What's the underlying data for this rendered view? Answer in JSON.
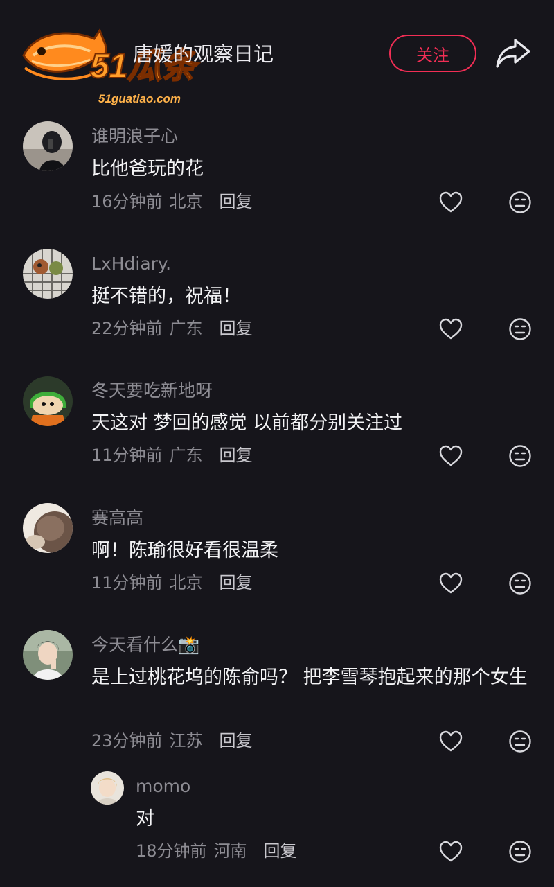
{
  "header": {
    "watermark_logo": "51瓜条",
    "watermark_site": "51guatiao.com",
    "title": "唐媛的观察日记",
    "follow_label": "关注"
  },
  "comments": [
    {
      "username": "谁明浪子心",
      "text": "比他爸玩的花",
      "time": "16分钟前",
      "location": "北京",
      "reply_label": "回复"
    },
    {
      "username": "LxHdiary.",
      "text": "挺不错的，祝福！",
      "time": "22分钟前",
      "location": "广东",
      "reply_label": "回复"
    },
    {
      "username": "冬天要吃新地呀",
      "text": "天这对 梦回的感觉 以前都分别关注过",
      "time": "11分钟前",
      "location": "广东",
      "reply_label": "回复"
    },
    {
      "username": "赛高高",
      "text": "啊！陈瑜很好看很温柔",
      "time": "11分钟前",
      "location": "北京",
      "reply_label": "回复"
    },
    {
      "username": "今天看什么📸",
      "text": "是上过桃花坞的陈俞吗？ 把李雪琴抱起来的那个女生",
      "time": "23分钟前",
      "location": "江苏",
      "reply_label": "回复"
    },
    {
      "username": "momo",
      "text": "对",
      "time": "18分钟前",
      "location": "河南",
      "reply_label": "回复"
    }
  ],
  "colors": {
    "background": "#16151b",
    "accent": "#f22e55",
    "secondary_text": "#8d8c93"
  },
  "icons": {
    "share": "share-arrow-icon",
    "like": "heart-outline-icon",
    "dislike": "meh-face-icon"
  }
}
